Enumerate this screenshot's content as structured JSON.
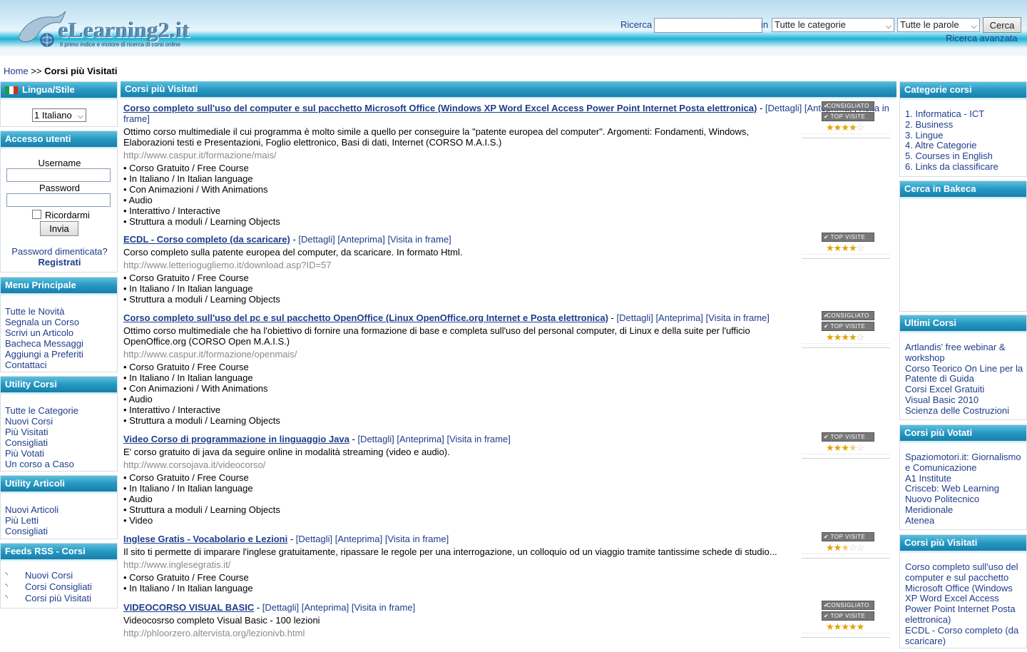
{
  "header": {
    "logo_text": "eLearning2.it",
    "logo_tagline": "Il primo indice e motore di ricerca di corsi online",
    "search_label": "Ricerca",
    "search_value": "",
    "in_label": "in",
    "category_select": "Tutte le categorie",
    "words_select": "Tutte le parole",
    "search_button": "Cerca",
    "advanced_link": "Ricerca avanzata"
  },
  "breadcrumb": {
    "home": "Home",
    "sep": ">>",
    "current": "Corsi più Visitati"
  },
  "left": {
    "lang": {
      "title": "Lingua/Stile",
      "selected": "1 Italiano"
    },
    "login": {
      "title": "Accesso utenti",
      "username_label": "Username",
      "password_label": "Password",
      "remember_label": "Ricordarmi",
      "submit": "Invia",
      "forgot": "Password dimenticata?",
      "register": "Registrati"
    },
    "menu": {
      "title": "Menu Principale",
      "items": [
        "Tutte le Novità",
        "Segnala un Corso",
        "Scrivi un Articolo",
        "Bacheca Messaggi",
        "Aggiungi a Preferiti",
        "Contattaci"
      ]
    },
    "utility": {
      "title": "Utility Corsi",
      "items": [
        "Tutte le Categorie",
        "Nuovi Corsi",
        "Più Visitati",
        "Consigliati",
        "Più Votati",
        "Un corso a Caso"
      ]
    },
    "articoli": {
      "title": "Utility Articoli",
      "items": [
        "Nuovi Articoli",
        "Più Letti",
        "Consigliati"
      ]
    },
    "rss": {
      "title": "Feeds RSS - Corsi",
      "items": [
        "Nuovi Corsi",
        "Corsi Consigliati",
        "Corsi più Visitati"
      ]
    }
  },
  "main": {
    "title": "Corsi più Visitati",
    "details": "[Dettagli]",
    "preview": "[Anteprima]",
    "frame": "[Visita in frame]",
    "badge_consigliato": "CONSIGLIATO",
    "badge_top": "TOP VISITE",
    "courses": [
      {
        "title": "Corso completo sull'uso del computer e sul pacchetto Microsoft Office (Windows XP Word Excel Access Power Point Internet Posta elettronica)",
        "desc": "Ottimo corso multimediale il cui programma è molto simile a quello per conseguire la \"patente europea del computer\". Argomenti: Fondamenti, Windows, Elaborazioni testi e Presentazioni, Foglio elettronico, Basi di dati, Internet (CORSO M.A.I.S.)",
        "url": "http://www.caspur.it/formazione/mais/",
        "features": [
          "• Corso Gratuito / Free Course",
          "• In Italiano / In Italian language",
          "• Con Animazioni / With Animations",
          "• Audio",
          "• Interattivo / Interactive",
          "• Struttura a moduli / Learning Objects"
        ],
        "consigliato": true,
        "rating": 4
      },
      {
        "title": "ECDL - Corso completo (da scaricare)",
        "desc": "Corso completo sulla patente europea del computer, da scaricare. In formato Html.",
        "url": "http://www.letteriogugliemo.it/download.asp?ID=57",
        "features": [
          "• Corso Gratuito / Free Course",
          "• In Italiano / In Italian language",
          "• Struttura a moduli / Learning Objects"
        ],
        "consigliato": false,
        "rating": 4
      },
      {
        "title": "Corso completo sull'uso del pc e sul pacchetto OpenOffice (Linux OpenOffice.org Internet e Posta elettronica)",
        "desc": "Ottimo corso multimediale che ha l'obiettivo di fornire una formazione di base e completa sull'uso del personal computer, di Linux e della suite per l'ufficio OpenOffice.org (CORSO Open M.A.I.S.)",
        "url": "http://www.caspur.it/formazione/openmais/",
        "features": [
          "• Corso Gratuito / Free Course",
          "• In Italiano / In Italian language",
          "• Con Animazioni / With Animations",
          "• Audio",
          "• Interattivo / Interactive",
          "• Struttura a moduli / Learning Objects"
        ],
        "consigliato": true,
        "rating": 4
      },
      {
        "title": "Video Corso di programmazione in linguaggio Java",
        "desc": "E' corso gratuito di java da seguire online in modalità streaming (video e audio).",
        "url": "http://www.corsojava.it/videocorso/",
        "features": [
          "• Corso Gratuito / Free Course",
          "• In Italiano / In Italian language",
          "• Audio",
          "• Struttura a moduli / Learning Objects",
          "• Video"
        ],
        "consigliato": false,
        "rating": 3.5
      },
      {
        "title": "Inglese Gratis - Vocabolario e Lezioni",
        "desc": "Il sito ti permette di imparare l'inglese gratuitamente, ripassare le regole per una interrogazione, un colloquio od un viaggio tramite tantissime schede di studio...",
        "url": "http://www.inglesegratis.it/",
        "features": [
          "• Corso Gratuito / Free Course",
          "• In Italiano / In Italian language"
        ],
        "consigliato": false,
        "rating": 2.5
      },
      {
        "title": "VIDEOCORSO VISUAL BASIC",
        "desc": "Videocosrso completo Visual Basic - 100 lezioni",
        "url": "http://phloorzero.altervista.org/lezionivb.html",
        "features": [],
        "consigliato": true,
        "rating": 5
      }
    ]
  },
  "right": {
    "categorie": {
      "title": "Categorie corsi",
      "items": [
        "1. Informatica - ICT",
        "2. Business",
        "3. Lingue",
        "4. Altre Categorie",
        "5. Courses in English",
        "6. Links da classificare"
      ]
    },
    "bakeca": {
      "title": "Cerca in Bakeca"
    },
    "ultimi": {
      "title": "Ultimi Corsi",
      "items": [
        "Artlandis' free webinar & workshop",
        "Corso Teorico On Line per la Patente di Guida",
        "Corsi Excel Gratuiti",
        "Visual Basic 2010",
        "Scienza delle Costruzioni"
      ]
    },
    "votati": {
      "title": "Corsi più Votati",
      "items": [
        "Spaziomotori.it: Giornalismo e Comunicazione",
        "A1 Institute",
        "Crisceb: Web Learning",
        "Nuovo Politecnico",
        "Meridionale",
        "Atenea"
      ]
    },
    "visitati": {
      "title": "Corsi più Visitati",
      "items": [
        "Corso completo sull'uso del computer e sul pacchetto Microsoft Office (Windows XP Word Excel Access Power Point Internet Posta elettronica)",
        "ECDL - Corso completo (da scaricare)"
      ]
    }
  }
}
